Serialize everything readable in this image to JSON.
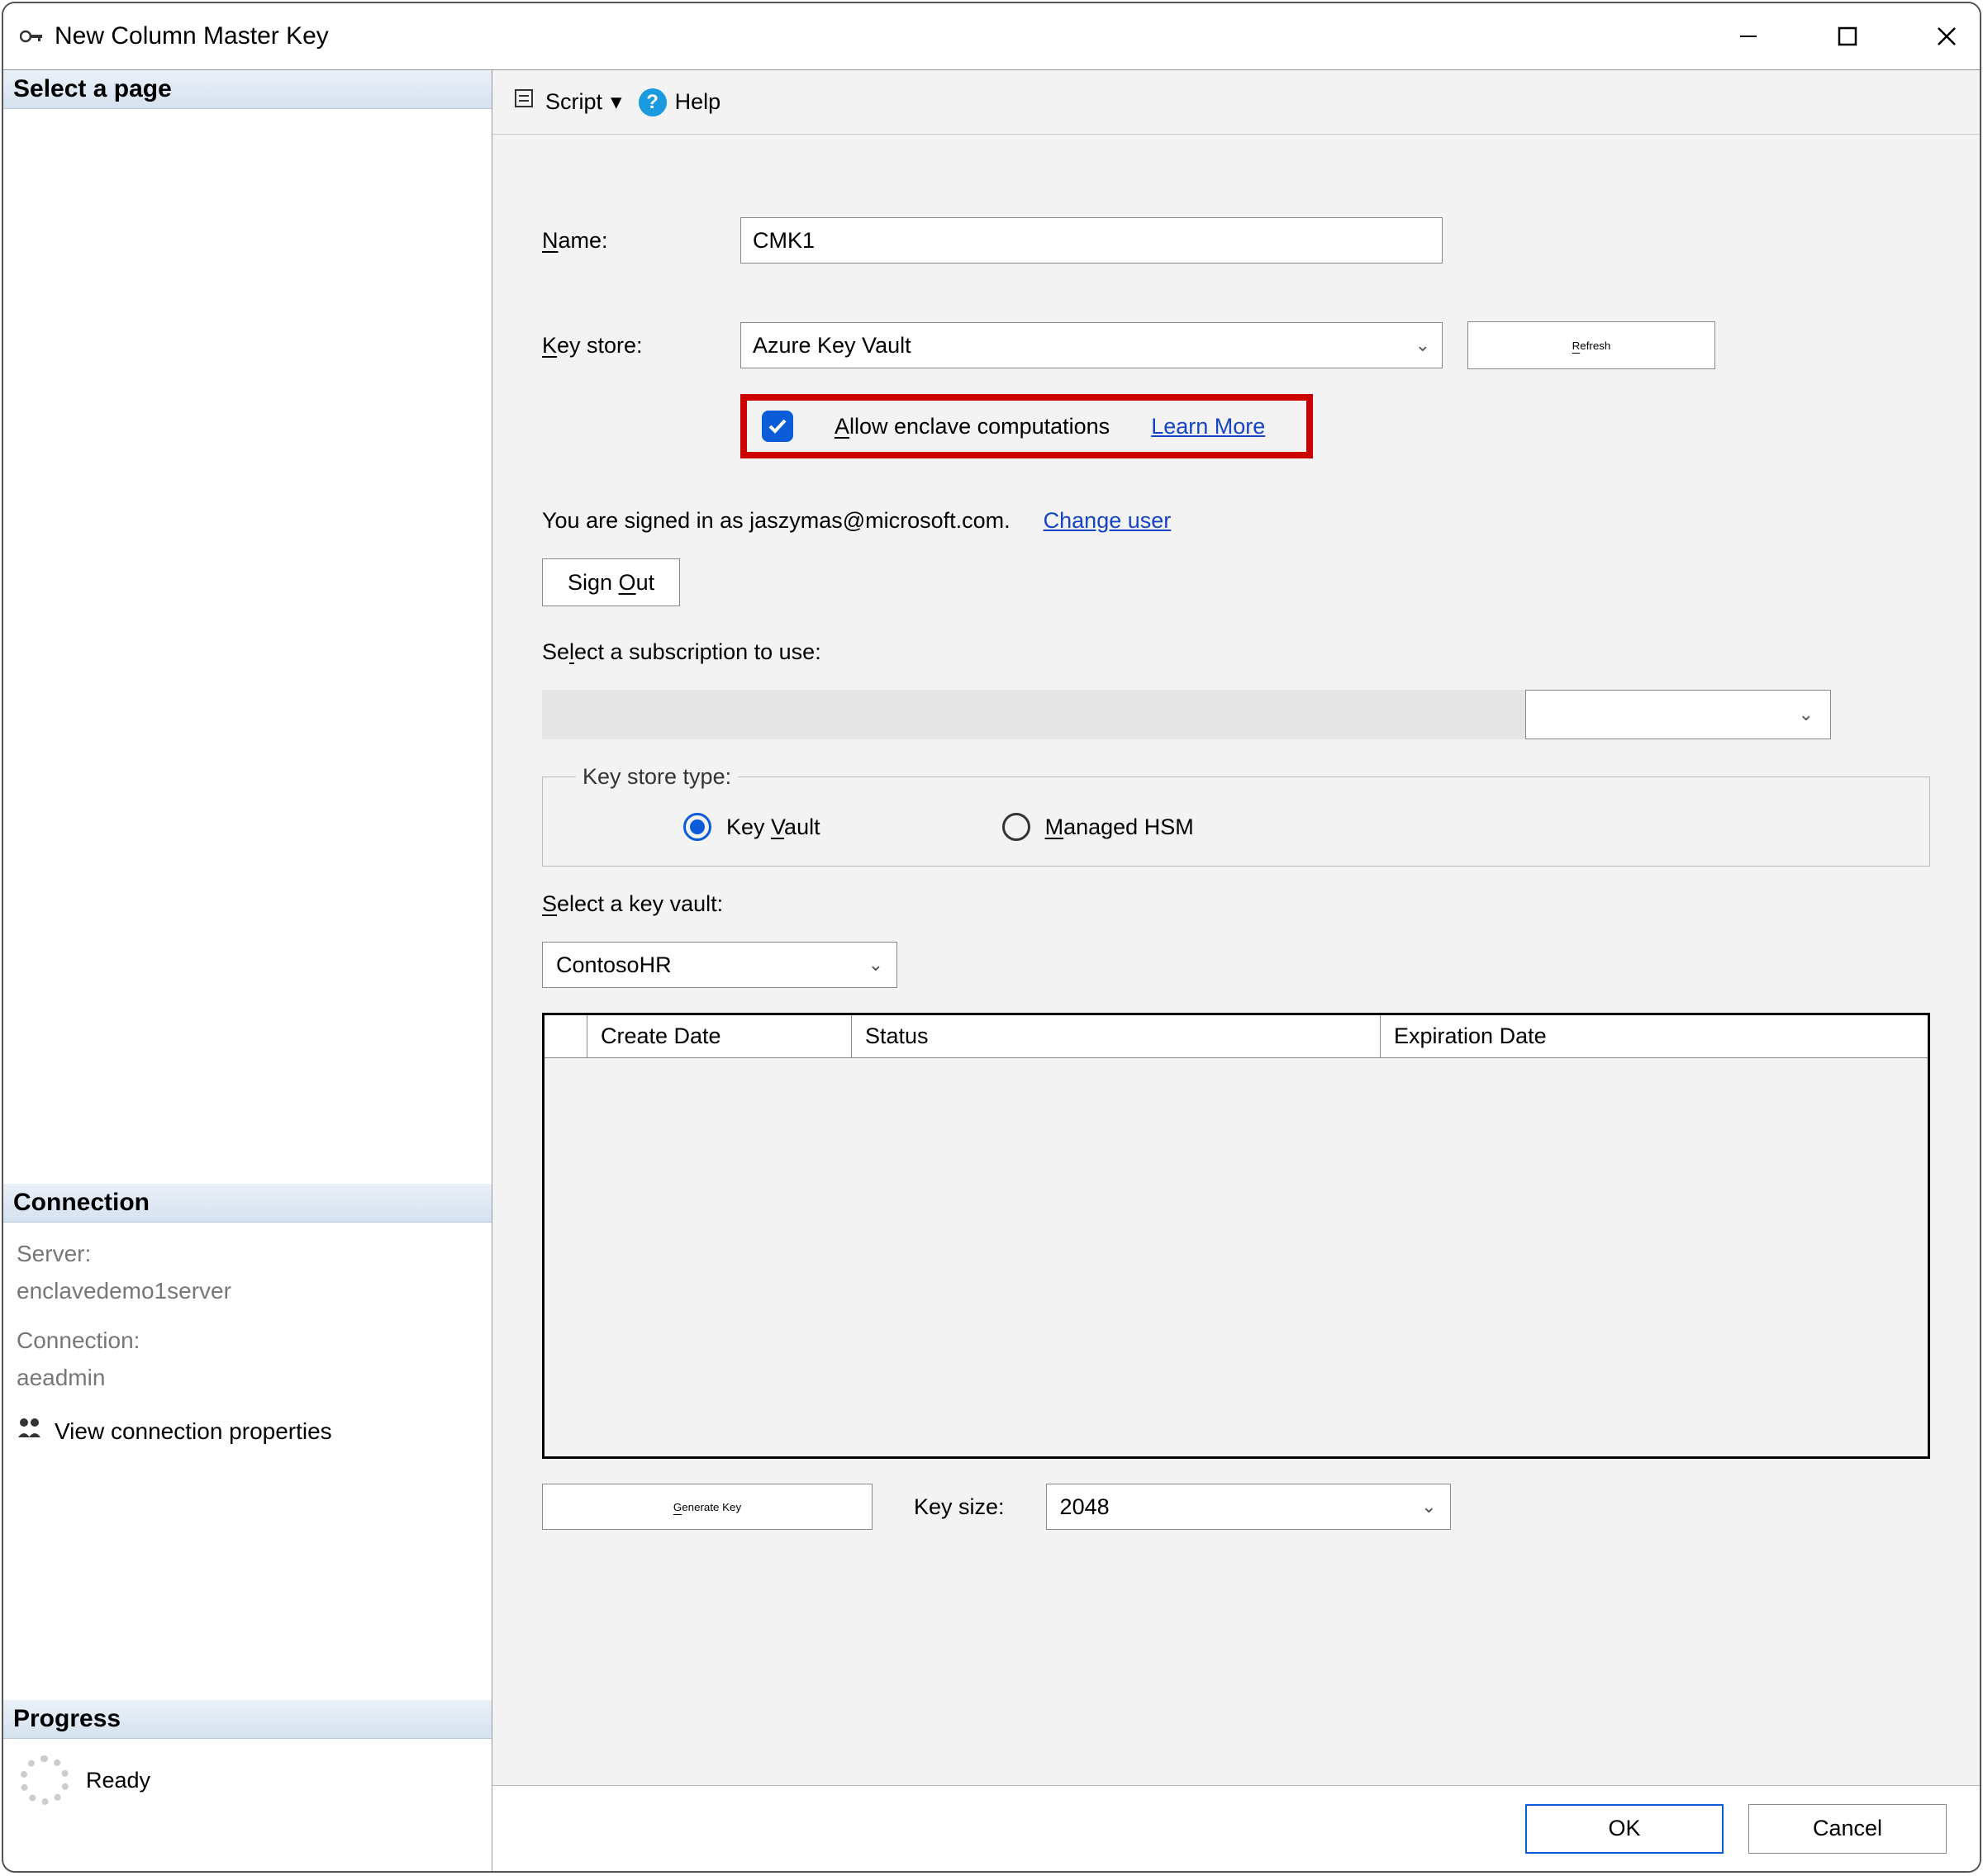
{
  "window": {
    "title": "New Column Master Key"
  },
  "sidebar": {
    "select_page": "Select a page",
    "connection_header": "Connection",
    "server_label": "Server:",
    "server_value": "enclavedemo1server",
    "connection_label": "Connection:",
    "connection_value": "aeadmin",
    "view_conn_props": "View connection properties",
    "progress_header": "Progress",
    "progress_status": "Ready"
  },
  "toolbar": {
    "script_label": "Script",
    "help_label": "Help"
  },
  "form": {
    "name_label_pre": "N",
    "name_label_post": "ame:",
    "name_value": "CMK1",
    "keystore_label_pre": "K",
    "keystore_label_post": "ey store:",
    "keystore_value": "Azure Key Vault",
    "refresh_label_pre": "R",
    "refresh_label_post": "efresh",
    "enclave_pre": "A",
    "enclave_post": "llow enclave computations",
    "learn_more": "Learn More",
    "signed_in_text": "You are signed in as jaszymas@microsoft.com.",
    "change_user": "Change user",
    "sign_out_pre": "Sign ",
    "sign_out_u": "O",
    "sign_out_post": "ut",
    "select_sub_pre": "Se",
    "select_sub_u": "l",
    "select_sub_post": "ect a subscription to use:",
    "key_store_type": "Key store type:",
    "kv_radio_pre": "Key ",
    "kv_radio_u": "V",
    "kv_radio_post": "ault",
    "hsm_radio_pre": "M",
    "hsm_radio_post": "anaged HSM",
    "select_kv_pre": "S",
    "select_kv_post": "elect a key vault:",
    "kv_value": "ContosoHR",
    "table_cols": {
      "c1": "Create Date",
      "c2": "Status",
      "c3": "Expiration Date"
    },
    "generate_pre": "G",
    "generate_post": "enerate Key",
    "key_size_label": "Key size:",
    "key_size_value": "2048"
  },
  "footer": {
    "ok": "OK",
    "cancel": "Cancel"
  }
}
